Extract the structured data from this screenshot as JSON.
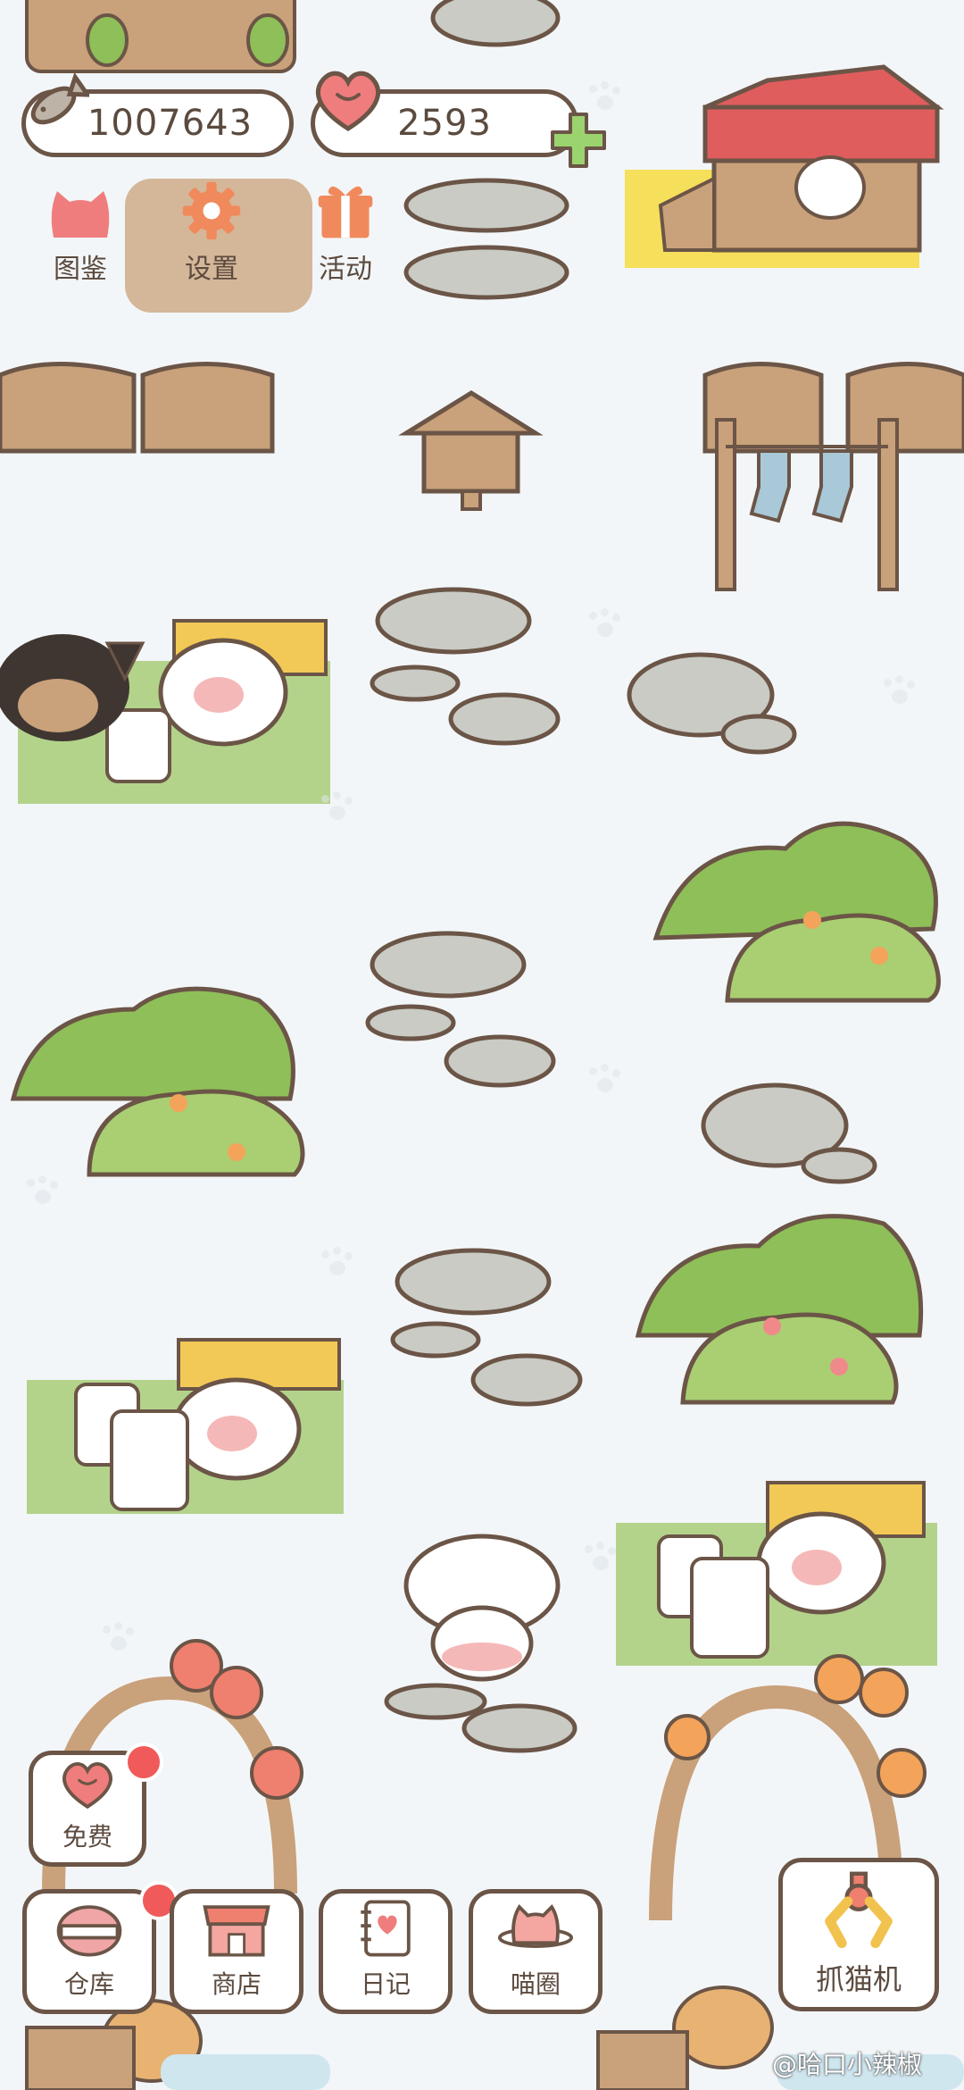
{
  "hud": {
    "coins": "1007643",
    "hearts": "2593",
    "plus_icon": "plus-icon"
  },
  "top_menu": [
    {
      "label": "图鉴",
      "icon": "cat-head-icon"
    },
    {
      "label": "设置",
      "icon": "gear-icon"
    },
    {
      "label": "活动",
      "icon": "gift-icon"
    }
  ],
  "bottom_menu": {
    "free": {
      "label": "免费",
      "icon": "heart-icon",
      "has_badge": true
    },
    "warehouse": {
      "label": "仓库",
      "icon": "basket-icon",
      "has_badge": true
    },
    "shop": {
      "label": "商店",
      "icon": "shop-icon"
    },
    "diary": {
      "label": "日记",
      "icon": "diary-icon"
    },
    "cat_circle": {
      "label": "喵圈",
      "icon": "cat-planet-icon"
    },
    "claw_machine": {
      "label": "抓猫机",
      "icon": "claw-icon"
    }
  },
  "watermark": "@哈口小辣椒",
  "colors": {
    "outline": "#6b5547",
    "background": "#f3f6f8",
    "badge_red": "#f05a5a",
    "heart_pink": "#f07d7d",
    "grass_green": "#8fbf58",
    "wood_brown": "#c9a17a",
    "plus_green": "#9bd36e"
  }
}
